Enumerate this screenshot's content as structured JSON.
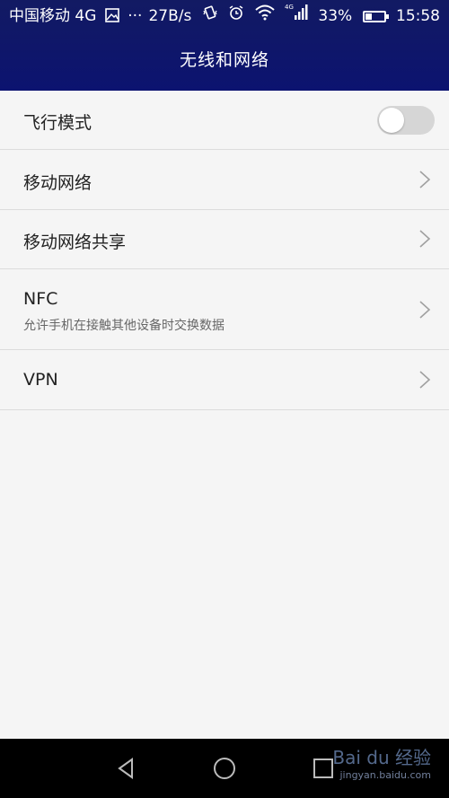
{
  "status_bar": {
    "carrier": "中国移动 4G",
    "dots": "···",
    "speed": "27B/s",
    "battery": "33%",
    "battery_level": 0.33,
    "time": "15:58",
    "signal_tag": "4G"
  },
  "header": {
    "title": "无线和网络"
  },
  "settings": {
    "airplane": {
      "label": "飞行模式",
      "on": false
    },
    "mobile_network": {
      "label": "移动网络"
    },
    "tethering": {
      "label": "移动网络共享"
    },
    "nfc": {
      "label": "NFC",
      "sub": "允许手机在接触其他设备时交换数据"
    },
    "vpn": {
      "label": "VPN"
    }
  },
  "watermark": {
    "brand": "Bai du 经验",
    "url": "jingyan.baidu.com"
  },
  "colors": {
    "header_bg": "#0c1370",
    "list_bg": "#f5f5f5",
    "toggle_off": "#d6d6d6"
  }
}
